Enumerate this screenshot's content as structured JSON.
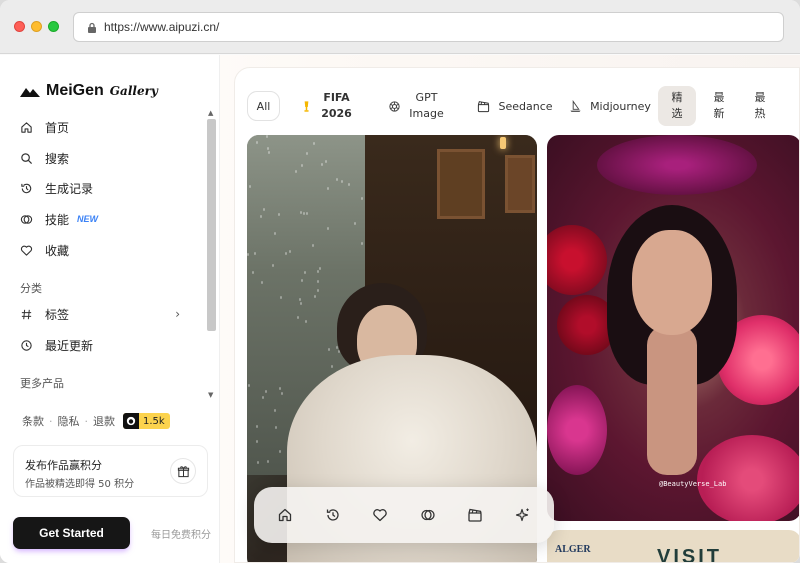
{
  "browser": {
    "url": "https://www.aipuzi.cn/"
  },
  "sidebar": {
    "brand": "MeiGen",
    "brand_script": "Gallery",
    "nav": [
      {
        "label": "首页",
        "icon": "home-icon"
      },
      {
        "label": "搜索",
        "icon": "search-icon"
      },
      {
        "label": "生成记录",
        "icon": "history-icon"
      },
      {
        "label": "技能",
        "icon": "skills-icon",
        "badge": "NEW"
      },
      {
        "label": "收藏",
        "icon": "heart-icon"
      }
    ],
    "section_category": "分类",
    "category_items": [
      {
        "label": "标签",
        "icon": "hash-icon"
      },
      {
        "label": "最近更新",
        "icon": "clock-icon"
      }
    ],
    "section_more": "更多产品",
    "footer_links": [
      "条款",
      "隐私",
      "退款"
    ],
    "github_count": "1.5k",
    "promo": {
      "title": "发布作品赢积分",
      "subtitle": "作品被精选即得 50 积分"
    },
    "get_started": "Get Started",
    "daily_hint": "每日免费积分"
  },
  "filters": {
    "all": "All",
    "fifa_line1": "FIFA",
    "fifa_line2": "2026",
    "gpt_line1": "GPT",
    "gpt_line2": "Image",
    "seedance": "Seedance",
    "midjourney": "Midjourney",
    "featured_line1": "精",
    "featured_line2": "选",
    "latest_line1": "最",
    "latest_line2": "新",
    "hot_line1": "最",
    "hot_line2": "热"
  },
  "gallery": {
    "watermark": "@BeautyVerse_Lab",
    "card3_left": "ALGER",
    "card3_text": "VISIT"
  },
  "colors": {
    "accent_new": "#3b82f6",
    "github_badge": "#fcd34d",
    "button_dark": "#161616"
  }
}
